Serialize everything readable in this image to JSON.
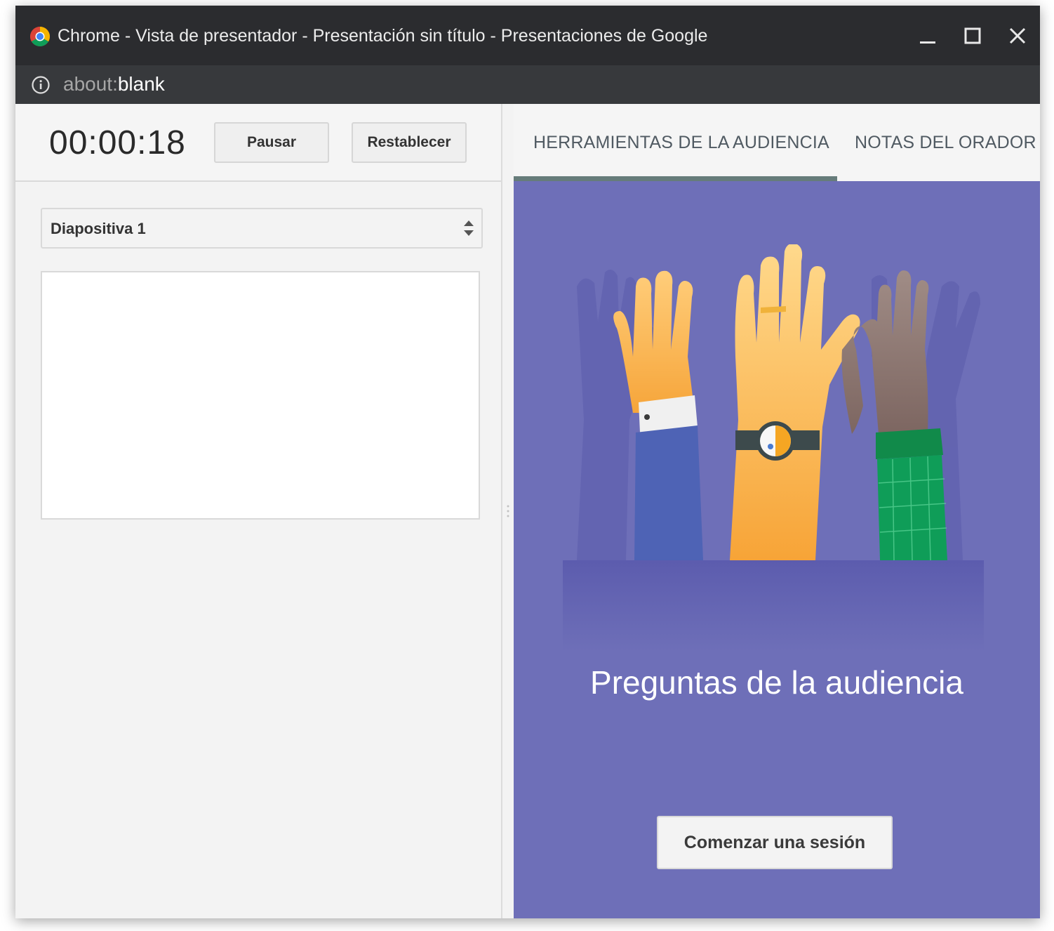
{
  "window": {
    "title": "Chrome - Vista de presentador - Presentación sin título - Presentaciones de Google",
    "controls": {
      "minimize_icon": "minimize-icon",
      "maximize_icon": "maximize-icon",
      "close_icon": "close-icon"
    }
  },
  "address_bar": {
    "url_scheme": "about:",
    "url_path": "blank",
    "info_icon": "info-icon"
  },
  "timer_panel": {
    "elapsed": "00:00:18",
    "pause_label": "Pausar",
    "reset_label": "Restablecer"
  },
  "slide_selector": {
    "selected": "Diapositiva 1"
  },
  "tabs": [
    {
      "label": "HERRAMIENTAS DE LA AUDIENCIA",
      "active": true
    },
    {
      "label": "NOTAS DEL ORADOR",
      "active": false
    }
  ],
  "audience_panel": {
    "heading": "Preguntas de la audiencia",
    "start_label": "Comenzar una sesión",
    "illustration": "raised-hands-illustration",
    "background_color": "#6e6fb8"
  },
  "colors": {
    "titlebar": "#2b2c2f",
    "addressbar": "#37393c",
    "tab_active_underline": "#667c7a",
    "panel_purple": "#6e6fb8"
  }
}
